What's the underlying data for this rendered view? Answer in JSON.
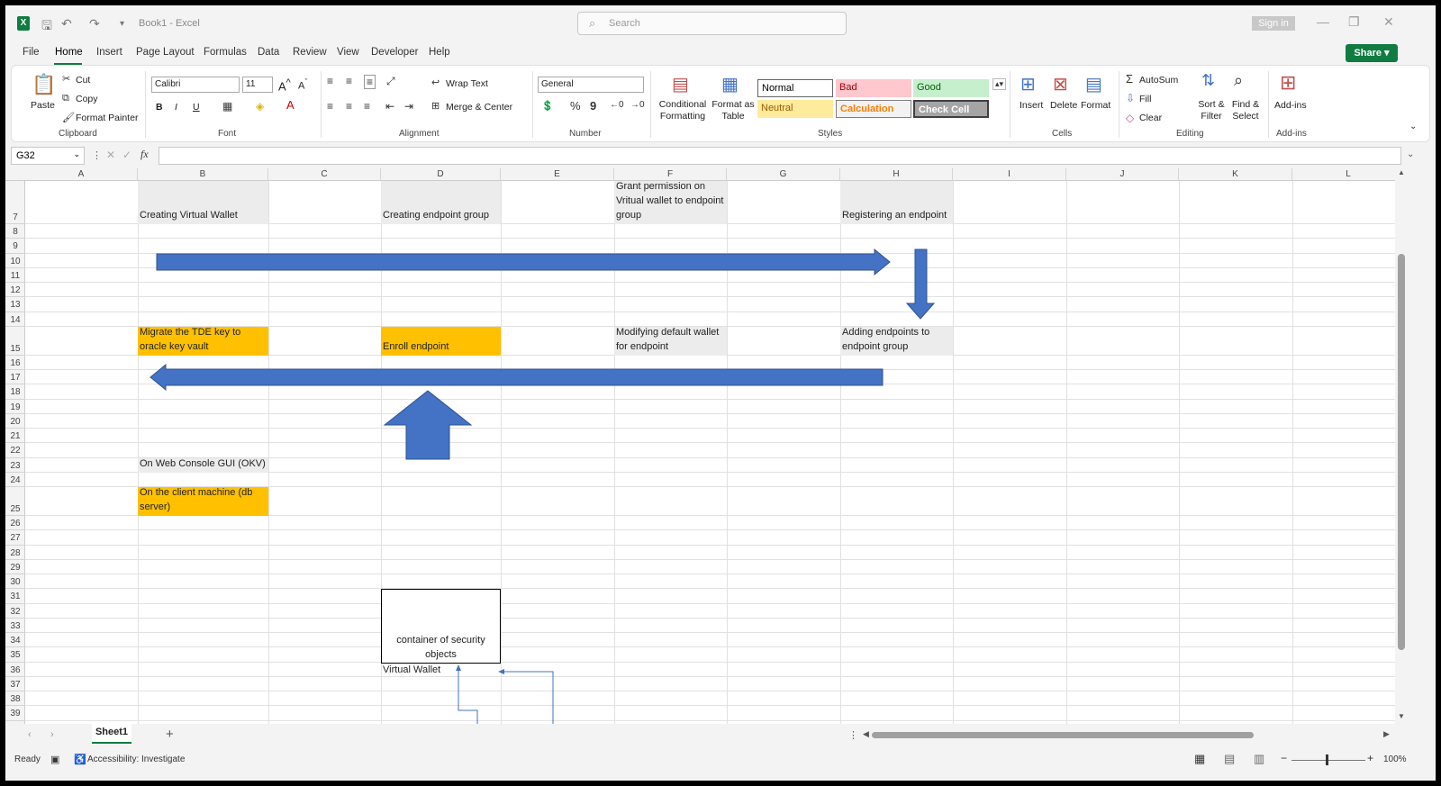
{
  "titlebar": {
    "doc_title": "Book1 - Excel",
    "search_placeholder": "Search",
    "signin": "Sign in"
  },
  "menu": [
    "File",
    "Home",
    "Insert",
    "Page Layout",
    "Formulas",
    "Data",
    "Review",
    "View",
    "Developer",
    "Help"
  ],
  "share_label": "Share",
  "ribbon": {
    "clipboard": {
      "paste": "Paste",
      "cut": "Cut",
      "copy": "Copy",
      "format_painter": "Format Painter",
      "label": "Clipboard"
    },
    "font": {
      "name": "Calibri",
      "size": "11",
      "bold": "B",
      "italic": "I",
      "underline": "U",
      "label": "Font"
    },
    "alignment": {
      "wrap": "Wrap Text",
      "merge": "Merge & Center",
      "label": "Alignment"
    },
    "number": {
      "format": "General",
      "label": "Number"
    },
    "styles": {
      "conditional": "Conditional Formatting",
      "format_table": "Format as Table",
      "normal": "Normal",
      "bad": "Bad",
      "good": "Good",
      "neutral": "Neutral",
      "calculation": "Calculation",
      "check_cell": "Check Cell",
      "label": "Styles"
    },
    "cells": {
      "insert": "Insert",
      "delete": "Delete",
      "format": "Format",
      "label": "Cells"
    },
    "editing": {
      "autosum": "AutoSum",
      "fill": "Fill",
      "clear": "Clear",
      "sort": "Sort & Filter",
      "find": "Find & Select",
      "label": "Editing"
    },
    "addins": {
      "addins": "Add-ins",
      "label": "Add-ins"
    }
  },
  "namebox": "G32",
  "columns": [
    "A",
    "B",
    "C",
    "D",
    "E",
    "F",
    "G",
    "H",
    "I",
    "J",
    "K",
    "L"
  ],
  "rows": [
    "7",
    "8",
    "9",
    "10",
    "11",
    "12",
    "13",
    "14",
    "15",
    "16",
    "17",
    "18",
    "19",
    "20",
    "21",
    "22",
    "23",
    "24",
    "25",
    "26",
    "27",
    "28",
    "29",
    "30",
    "31",
    "32",
    "33",
    "34",
    "35",
    "36",
    "37",
    "38",
    "39"
  ],
  "cells": {
    "b7": "Creating Virtual Wallet",
    "d7": "Creating endpoint group",
    "f7": "Grant permission on Vritual wallet to endpoint group",
    "h7": "Registering an endpoint",
    "b15": "Migrate the TDE key to oracle key vault",
    "d15": "Enroll endpoint",
    "f15": "Modifying default wallet for endpoint",
    "h15": "Adding endpoints to endpoint group",
    "b23": "On Web Console GUI (OKV)",
    "b25": "On the client machine (db server)",
    "box": "container of security objects",
    "d36": "Virtual Wallet"
  },
  "sheet_tab": "Sheet1",
  "status": {
    "ready": "Ready",
    "accessibility": "Accessibility: Investigate",
    "zoom": "100%"
  },
  "colors": {
    "arrow": "#4472c4",
    "orange": "#ffc000",
    "gray": "#ececec",
    "accent": "#107c41"
  }
}
